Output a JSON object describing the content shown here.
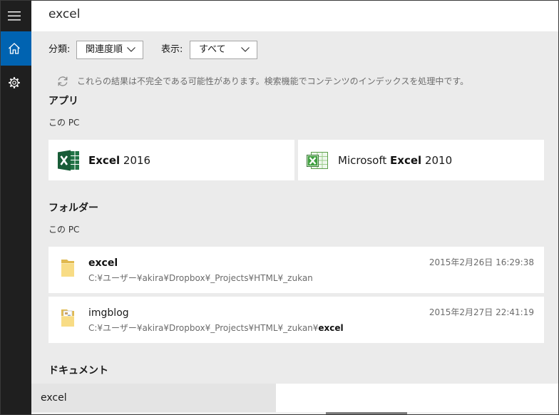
{
  "colors": {
    "sidebar": "#1f1f1f",
    "accent": "#0063b1",
    "background": "#ebebeb",
    "card": "#ffffff",
    "secondary_text": "#6b6b6b",
    "excel_green": "#217346"
  },
  "search": {
    "query": "excel"
  },
  "sidebar": {
    "items": [
      {
        "icon": "hamburger-icon"
      },
      {
        "icon": "home-icon",
        "selected": true
      },
      {
        "icon": "gear-icon"
      }
    ]
  },
  "filters": {
    "sort": {
      "label": "分類:",
      "value": "関連度順"
    },
    "show": {
      "label": "表示:",
      "value": "すべて"
    }
  },
  "notice": {
    "icon": "refresh-icon",
    "text": "これらの結果は不完全である可能性があります。検索機能でコンテンツのインデックスを処理中です。"
  },
  "apps": {
    "heading": "アプリ",
    "location": "この PC",
    "items": [
      {
        "icon": "excel-2016-icon",
        "match": "Excel",
        "post": " 2016"
      },
      {
        "icon": "excel-2010-icon",
        "pre": "Microsoft ",
        "match": "Excel",
        "post": " 2010"
      }
    ]
  },
  "folders": {
    "heading": "フォルダー",
    "location": "この PC",
    "items": [
      {
        "icon": "folder-icon",
        "name_match": "excel",
        "path": "C:¥ユーザー¥akira¥Dropbox¥_Projects¥HTML¥_zukan",
        "modified": "2015年2月26日 16:29:38"
      },
      {
        "icon": "folder-with-files-icon",
        "name": "imgblog",
        "path": "C:¥ユーザー¥akira¥Dropbox¥_Projects¥HTML¥_zukan¥",
        "path_match": "excel",
        "modified": "2015年2月27日 22:41:19"
      }
    ]
  },
  "documents": {
    "heading": "ドキュメント"
  },
  "taskbar_search": {
    "value": "excel"
  }
}
